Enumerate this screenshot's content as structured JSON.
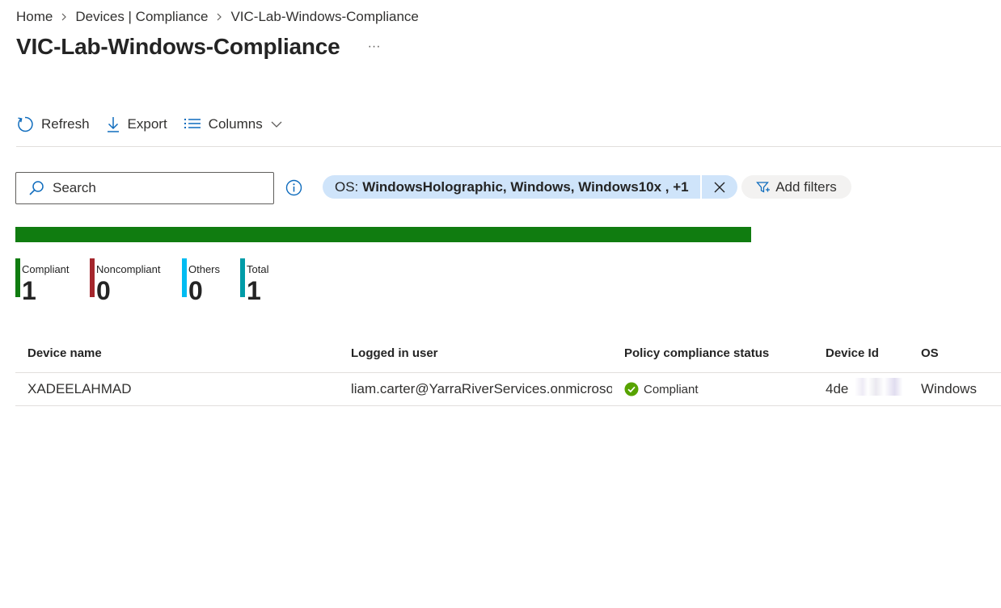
{
  "breadcrumb": {
    "items": [
      "Home",
      "Devices | Compliance",
      "VIC-Lab-Windows-Compliance"
    ]
  },
  "page": {
    "title": "VIC-Lab-Windows-Compliance",
    "more_label": "···"
  },
  "toolbar": {
    "refresh_label": "Refresh",
    "export_label": "Export",
    "columns_label": "Columns"
  },
  "search": {
    "placeholder": "Search"
  },
  "filters": {
    "active": {
      "key": "OS:",
      "value": "WindowsHolographic, Windows, Windows10x , +1"
    },
    "add_label": "Add filters"
  },
  "summary": {
    "compliant_fraction": 1.0,
    "stats": [
      {
        "label": "Compliant",
        "value": "1",
        "color": "#107c10"
      },
      {
        "label": "Noncompliant",
        "value": "0",
        "color": "#a4262c"
      },
      {
        "label": "Others",
        "value": "0",
        "color": "#00bcf2"
      },
      {
        "label": "Total",
        "value": "1",
        "color": "#009ca8"
      }
    ]
  },
  "table": {
    "columns": [
      "Device name",
      "Logged in user",
      "Policy compliance status",
      "Device Id",
      "OS"
    ],
    "rows": [
      {
        "device_name": "XADEELAHMAD",
        "logged_in_user": "liam.carter@YarraRiverServices.onmicrosoft.com",
        "status": "Compliant",
        "device_id_start": "4de",
        "device_id_end": "e",
        "os": "Windows"
      }
    ]
  },
  "colors": {
    "accent": "#0f6cbd",
    "compliant_green": "#107c10",
    "status_check": "#57a300",
    "filter_pill_bg": "#cfe4fa"
  },
  "icons": {
    "refresh": "refresh-icon",
    "export": "download-icon",
    "columns": "list-icon",
    "search": "search-icon",
    "info": "info-icon",
    "close": "close-icon",
    "filter": "filter-icon",
    "status": "check-circle-icon"
  }
}
